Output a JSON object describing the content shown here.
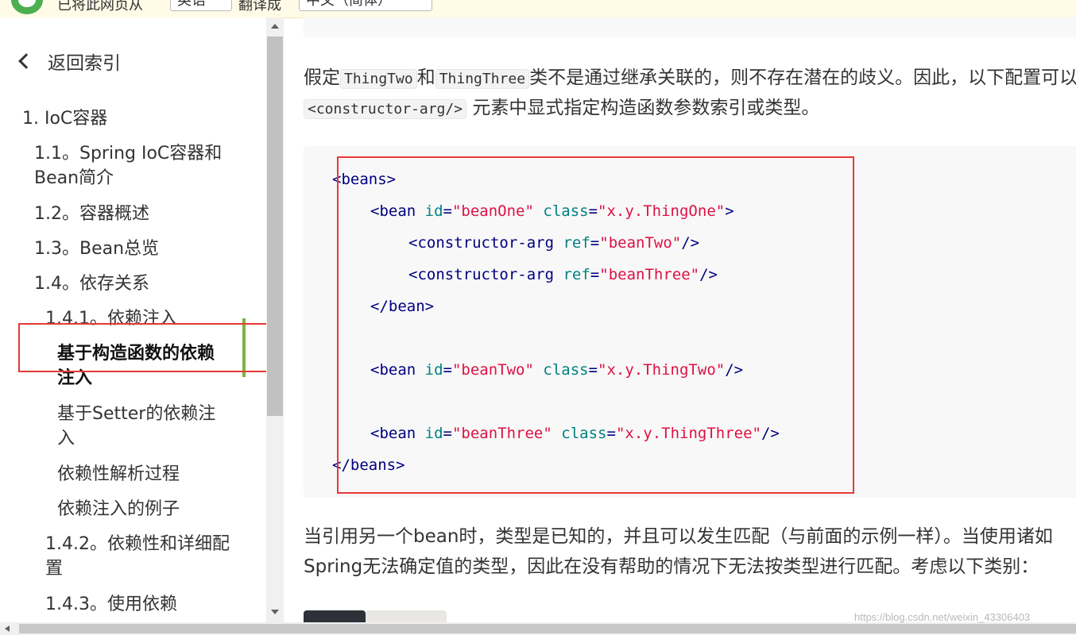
{
  "translate_bar": {
    "text1": "已将此网页从",
    "lang_from": "英语",
    "text2": "翻译成",
    "lang_to": "中文（简体）"
  },
  "sidebar": {
    "back_label": "返回索引",
    "items": [
      {
        "label": "1. IoC容器"
      },
      {
        "label": "1.1。Spring IoC容器和"
      },
      {
        "label": "Bean简介"
      },
      {
        "label": "1.2。容器概述"
      },
      {
        "label": "1.3。Bean总览"
      },
      {
        "label": "1.4。依存关系"
      },
      {
        "label": "1.4.1。依赖注入"
      },
      {
        "label": "基于构造函数的依赖"
      },
      {
        "label": "注入"
      },
      {
        "label": "基于Setter的依赖注"
      },
      {
        "label": "入"
      },
      {
        "label": "依赖性解析过程"
      },
      {
        "label": "依赖注入的例子"
      },
      {
        "label": "1.4.2。依赖性和详细配"
      },
      {
        "label": "置"
      },
      {
        "label": "1.4.3。使用依赖"
      }
    ]
  },
  "content": {
    "para1": {
      "a": "假定",
      "code1": "ThingTwo",
      "b": "和",
      "code2": "ThingThree",
      "c": "类不是通过继承关联的，则不存在潜在的歧义。因此，以下配置可以正常工作，并且您无需在",
      "code3": "<constructor-arg/>",
      "d": "元素中显式指定构造函数参数索引或类型。"
    },
    "code_lines": [
      {
        "tag_open": "<beans>"
      },
      {
        "t1": "<bean ",
        "a1": "id",
        "v1": "\"beanOne\"",
        "a2": "class",
        "v2": "\"x.y.ThingOne\"",
        "end": ">"
      },
      {
        "t1": "<constructor-arg ",
        "a1": "ref",
        "v1": "\"beanTwo\"",
        "end": "/>"
      },
      {
        "t1": "<constructor-arg ",
        "a1": "ref",
        "v1": "\"beanThree\"",
        "end": "/>"
      },
      {
        "tag_close": "</bean>"
      },
      {
        "t1": "<bean ",
        "a1": "id",
        "v1": "\"beanTwo\"",
        "a2": "class",
        "v2": "\"x.y.ThingTwo\"",
        "end": "/>"
      },
      {
        "t1": "<bean ",
        "a1": "id",
        "v1": "\"beanThree\"",
        "a2": "class",
        "v2": "\"x.y.ThingThree\"",
        "end": "/>"
      },
      {
        "tag_close": "</beans>"
      }
    ],
    "para2": {
      "line1": "当引用另一个bean时，类型是已知的，并且可以发生匹配（与前面的示例一样）。当使用诸如",
      "line2": "Spring无法确定值的类型，因此在没有帮助的情况下无法按类型进行匹配。考虑以下类别："
    }
  },
  "watermark": "https://blog.csdn.net/weixin_43306403"
}
